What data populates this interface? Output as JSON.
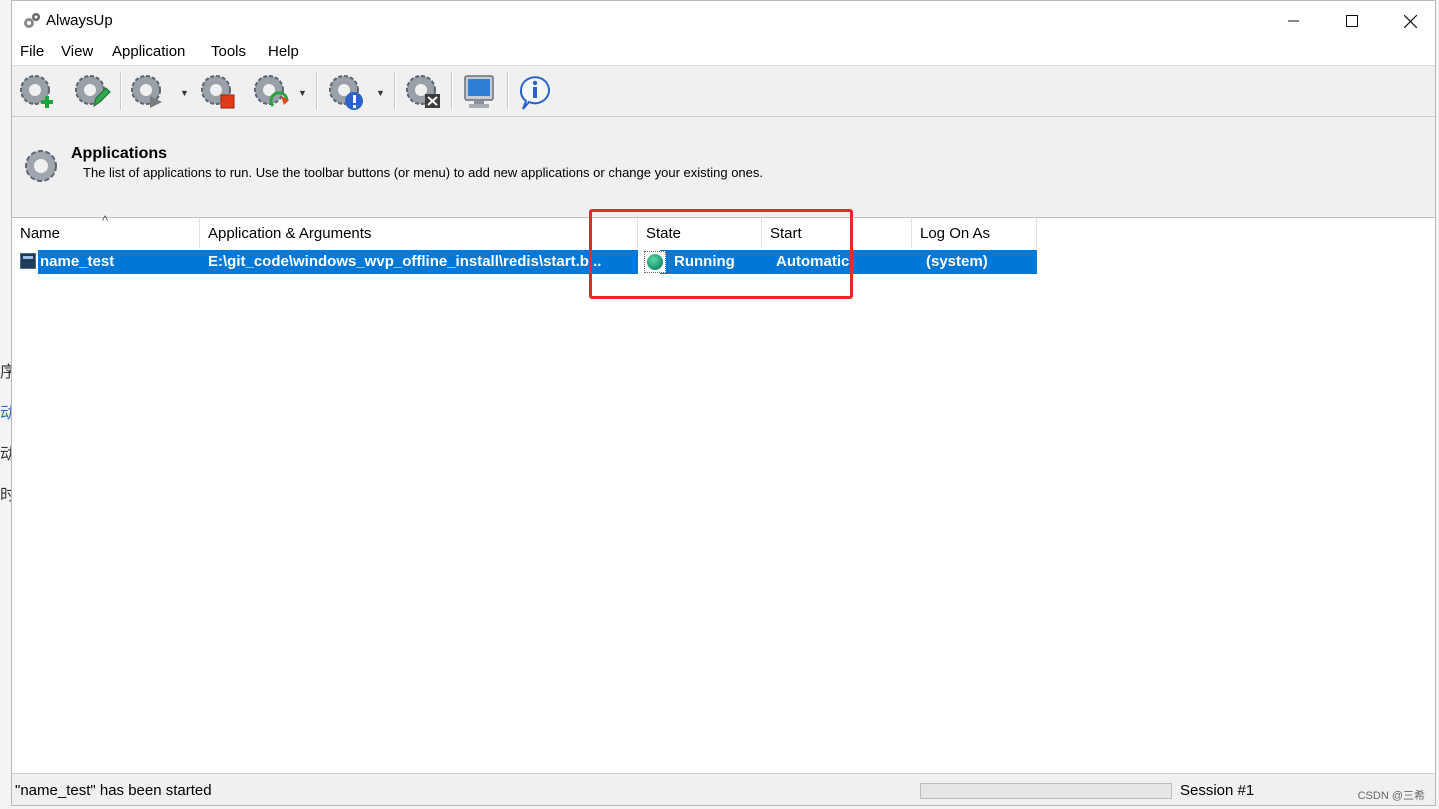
{
  "window": {
    "title": "AlwaysUp",
    "controls": [
      "minimize",
      "maximize",
      "close"
    ]
  },
  "menu": [
    "File",
    "View",
    "Application",
    "Tools",
    "Help"
  ],
  "toolbar": {
    "buttons": [
      {
        "name": "add-application-icon"
      },
      {
        "name": "edit-application-icon"
      },
      {
        "name": "start-application-icon"
      },
      {
        "name": "stop-application-icon"
      },
      {
        "name": "restart-application-icon"
      },
      {
        "name": "application-info-icon"
      },
      {
        "name": "delete-application-icon"
      },
      {
        "name": "computer-icon"
      },
      {
        "name": "help-info-icon"
      }
    ]
  },
  "header": {
    "title": "Applications",
    "description": "The list of applications to run. Use the toolbar buttons (or menu) to add new applications or change your existing ones."
  },
  "table": {
    "columns": [
      "Name",
      "Application & Arguments",
      "State",
      "Start",
      "Log On As"
    ],
    "rows": [
      {
        "name": "name_test",
        "app": "E:\\git_code\\windows_wvp_offline_install\\redis\\start.b...",
        "state": "Running",
        "start": "Automatic",
        "logon": "(system)",
        "selected": true
      }
    ]
  },
  "status": {
    "message": "\"name_test\" has been started",
    "session": "Session #1"
  },
  "watermark": "CSDN @三希",
  "background_chars": [
    "序",
    "动",
    "动",
    "时"
  ],
  "colors": {
    "selection": "#0078d7",
    "highlight_box": "#e8292a",
    "running_dot": "#16916b"
  }
}
